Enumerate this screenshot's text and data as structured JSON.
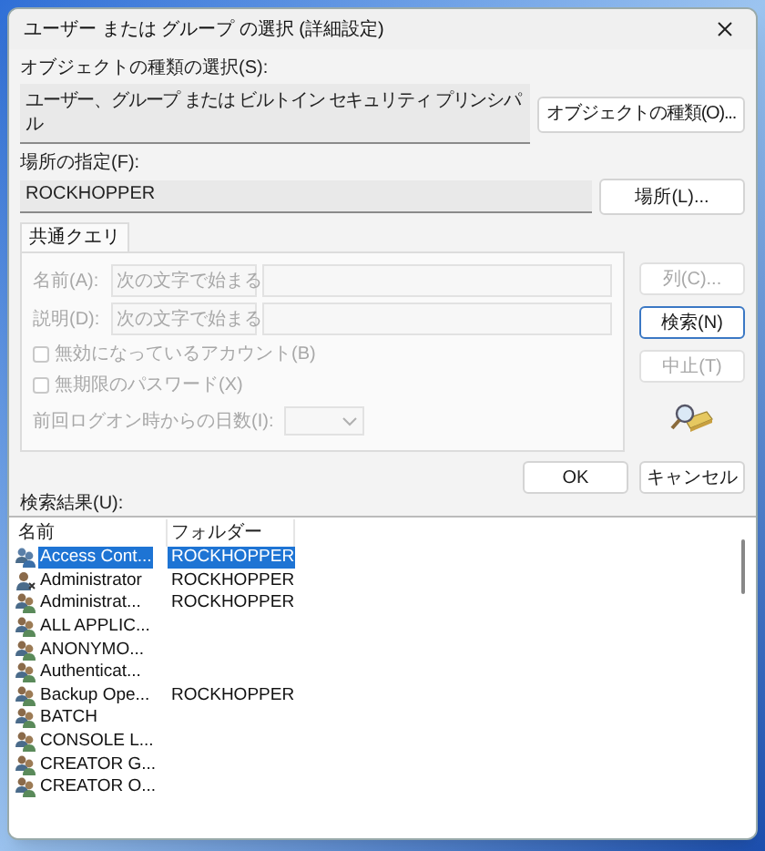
{
  "window": {
    "title": "ユーザー または グループ の選択 (詳細設定)"
  },
  "object_types": {
    "label": "オブジェクトの種類の選択(S):",
    "value": "ユーザー、グループ または ビルトイン セキュリティ プリンシパル",
    "button": "オブジェクトの種類(O)..."
  },
  "location": {
    "label": "場所の指定(F):",
    "value": "ROCKHOPPER",
    "button": "場所(L)..."
  },
  "tabs": [
    {
      "label": "共通クエリ",
      "selected": true
    }
  ],
  "query": {
    "fields": [
      {
        "label": "名前(A):",
        "option": "次の文字で始まる",
        "disabled": true
      },
      {
        "label": "説明(D):",
        "option": "次の文字で始まる",
        "disabled": true
      }
    ],
    "checkboxes": [
      {
        "label": "無効になっているアカウント(B)",
        "checked": false,
        "disabled": true
      },
      {
        "label": "無期限のパスワード(X)",
        "checked": false,
        "disabled": true
      }
    ],
    "days": {
      "label": "前回ログオン時からの日数(I):",
      "disabled": true
    }
  },
  "side_buttons": [
    {
      "label": "列(C)...",
      "disabled": true,
      "default": false
    },
    {
      "label": "検索(N)",
      "disabled": false,
      "default": true
    },
    {
      "label": "中止(T)",
      "disabled": true,
      "default": false
    }
  ],
  "buttons": [
    {
      "label": "OK"
    },
    {
      "label": "キャンセル"
    }
  ],
  "results": {
    "label": "検索結果(U):",
    "columns": [
      "名前",
      "フォルダー"
    ],
    "rows": [
      {
        "kind": "group",
        "name": "Access Cont...",
        "folder": "ROCKHOPPER",
        "selected": true
      },
      {
        "kind": "user",
        "name": "Administrator",
        "folder": "ROCKHOPPER",
        "selected": false
      },
      {
        "kind": "group",
        "name": "Administrat...",
        "folder": "ROCKHOPPER",
        "selected": false
      },
      {
        "kind": "group",
        "name": "ALL APPLIC...",
        "selected": false
      },
      {
        "kind": "group",
        "name": "ANONYMO...",
        "selected": false
      },
      {
        "kind": "group",
        "name": "Authenticat...",
        "selected": false
      },
      {
        "kind": "group",
        "name": "Backup Ope...",
        "folder": "ROCKHOPPER",
        "selected": false
      },
      {
        "kind": "group",
        "name": "BATCH",
        "selected": false
      },
      {
        "kind": "group",
        "name": "CONSOLE L...",
        "selected": false
      },
      {
        "kind": "group",
        "name": "CREATOR G...",
        "selected": false
      },
      {
        "kind": "group",
        "name": "CREATOR O...",
        "selected": false
      }
    ]
  }
}
